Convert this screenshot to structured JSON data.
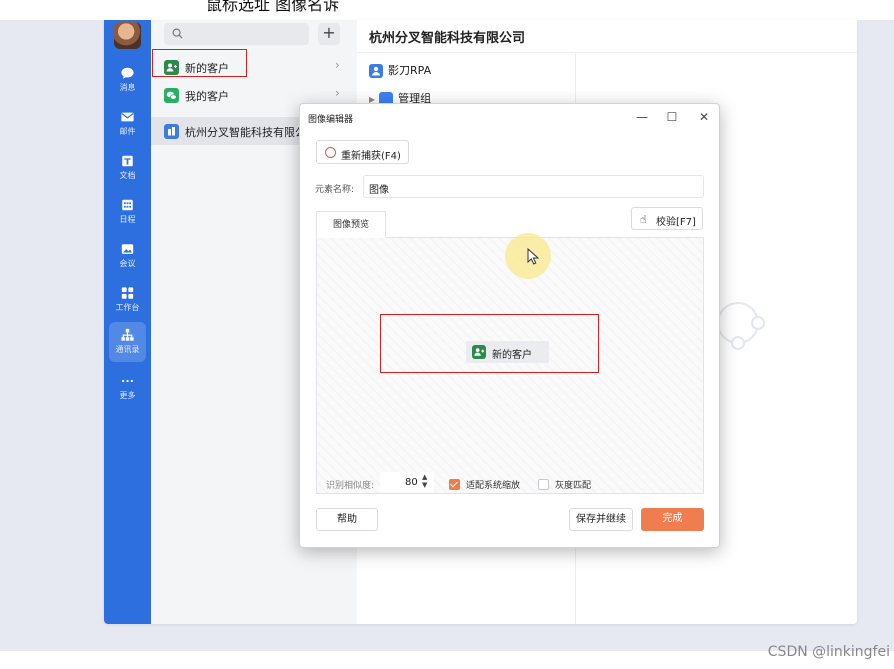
{
  "caption": {
    "text": "鼠标选址  图像名诉"
  },
  "watermark": "CSDN @linkingfei",
  "rail": {
    "items": [
      {
        "label": "消息",
        "icon": "chat-icon"
      },
      {
        "label": "邮件",
        "icon": "mail-icon"
      },
      {
        "label": "文档",
        "icon": "document-icon"
      },
      {
        "label": "日程",
        "icon": "calendar-icon"
      },
      {
        "label": "会议",
        "icon": "meeting-icon"
      },
      {
        "label": "工作台",
        "icon": "workbench-icon"
      },
      {
        "label": "通讯录",
        "icon": "contacts-icon"
      },
      {
        "label": "更多",
        "icon": "more-icon"
      }
    ],
    "active_index": 6
  },
  "list_panel": {
    "items": [
      {
        "label": "新的客户",
        "icon": "new-customer-icon",
        "color": "#2a8a4a"
      },
      {
        "label": "我的客户",
        "icon": "wechat-icon",
        "color": "#2aae67"
      },
      {
        "label": "杭州分叉智能科技有限公司",
        "icon": "company-icon",
        "color": "#3b7ce0"
      }
    ]
  },
  "content": {
    "title": "杭州分叉智能科技有限公司",
    "rows": [
      {
        "label": "影刀RPA",
        "icon": "person-icon",
        "color": "#3b7ce0"
      },
      {
        "label": "管理组",
        "icon": "folder-icon",
        "color": "#3b82f0"
      }
    ]
  },
  "dialog": {
    "title": "图像编辑器",
    "recapture_label": "重新捕获(F4)",
    "name_label": "元素名称:",
    "name_value": "图像",
    "tab_label": "图像预览",
    "verify_label": "校验[F7]",
    "captured_label": "新的客户",
    "similarity_label": "识别相似度:",
    "similarity_value": "80",
    "adapt_scaling_label": "适配系统缩放",
    "adapt_scaling_checked": true,
    "grayscale_label": "灰度匹配",
    "grayscale_checked": false,
    "help_label": "帮助",
    "save_continue_label": "保存并继续",
    "done_label": "完成",
    "accent_color": "#ef7d4f"
  }
}
